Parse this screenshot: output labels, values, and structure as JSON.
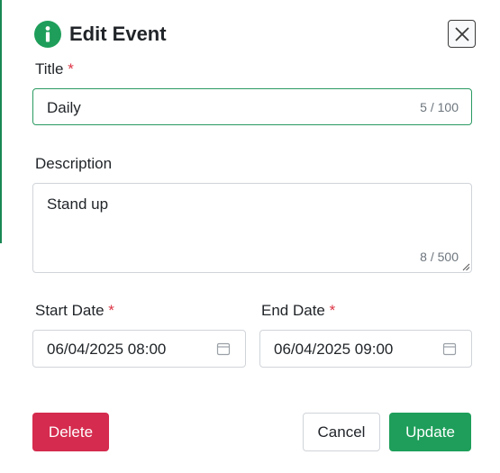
{
  "dialog": {
    "title": "Edit Event",
    "icon": "info-icon",
    "accent_color": "#1e9e5a"
  },
  "fields": {
    "title": {
      "label": "Title",
      "required_mark": "*",
      "value": "Daily",
      "counter": "5 / 100"
    },
    "description": {
      "label": "Description",
      "value": "Stand up",
      "counter": "8 / 500"
    },
    "start_date": {
      "label": "Start Date",
      "required_mark": "*",
      "value": "06/04/2025 08:00",
      "icon": "calendar-icon"
    },
    "end_date": {
      "label": "End Date",
      "required_mark": "*",
      "value": "06/04/2025 09:00",
      "icon": "calendar-icon"
    }
  },
  "actions": {
    "delete_label": "Delete",
    "cancel_label": "Cancel",
    "update_label": "Update",
    "delete_color": "#d52b4e",
    "update_color": "#1e9e5a"
  }
}
